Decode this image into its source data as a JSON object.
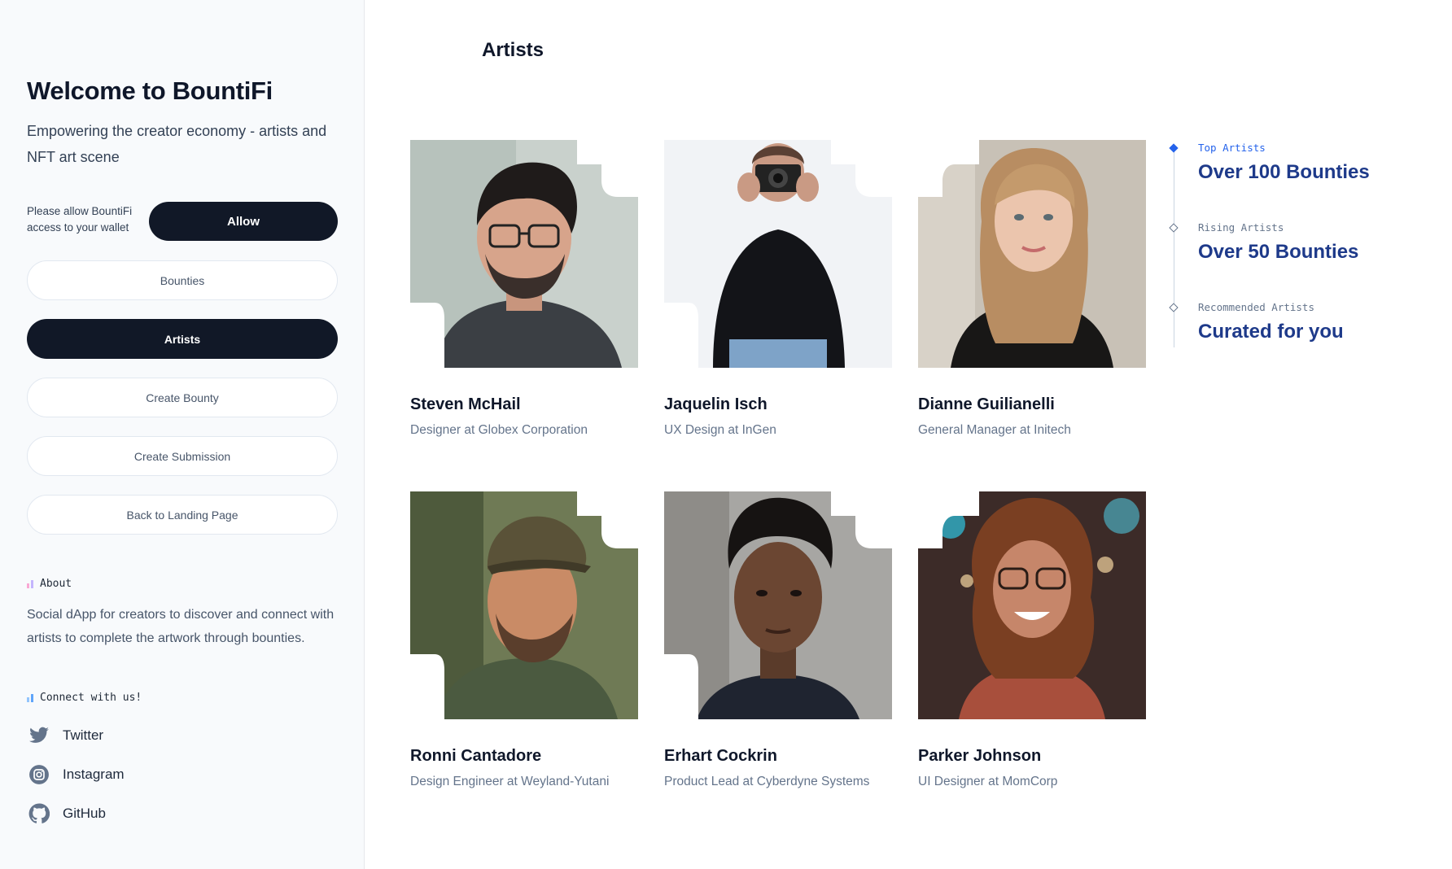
{
  "sidebar": {
    "title": "Welcome to BountiFi",
    "subtitle": "Empowering the creator economy - artists and NFT art scene",
    "allow_text": "Please allow BountiFi access to your wallet",
    "allow_label": "Allow",
    "nav": [
      {
        "label": "Bounties",
        "active": false
      },
      {
        "label": "Artists",
        "active": true
      },
      {
        "label": "Create Bounty",
        "active": false
      },
      {
        "label": "Create Submission",
        "active": false
      },
      {
        "label": "Back to Landing Page",
        "active": false
      }
    ],
    "about_heading": "About",
    "about_text": "Social dApp for creators to discover and connect with artists to complete the artwork through bounties.",
    "connect_heading": "Connect with us!",
    "socials": [
      {
        "label": "Twitter",
        "icon": "twitter-icon"
      },
      {
        "label": "Instagram",
        "icon": "instagram-icon"
      },
      {
        "label": "GitHub",
        "icon": "github-icon"
      }
    ]
  },
  "main": {
    "title": "Artists",
    "artists": [
      {
        "name": "Steven McHail",
        "role": "Designer at Globex Corporation",
        "avatar": "avatar-steven"
      },
      {
        "name": "Jaquelin Isch",
        "role": "UX Design at InGen",
        "avatar": "avatar-jaquelin"
      },
      {
        "name": "Dianne Guilianelli",
        "role": "General Manager at Initech",
        "avatar": "avatar-dianne"
      },
      {
        "name": "Ronni Cantadore",
        "role": "Design Engineer at Weyland-Yutani",
        "avatar": "avatar-ronni"
      },
      {
        "name": "Erhart Cockrin",
        "role": "Product Lead at Cyberdyne Systems",
        "avatar": "avatar-erhart"
      },
      {
        "name": "Parker Johnson",
        "role": "UI Designer at MomCorp",
        "avatar": "avatar-parker"
      }
    ]
  },
  "timeline": [
    {
      "label": "Top Artists",
      "value": "Over 100 Bounties",
      "active": true
    },
    {
      "label": "Rising Artists",
      "value": "Over 50 Bounties",
      "active": false
    },
    {
      "label": "Recommended Artists",
      "value": "Curated for you",
      "active": false
    }
  ],
  "colors": {
    "accent_dark": "#111827",
    "timeline_blue": "#1e3a8a",
    "timeline_active_label": "#2563eb",
    "wave_start": "#a5b4fc",
    "wave_end": "#f9a8d4"
  }
}
